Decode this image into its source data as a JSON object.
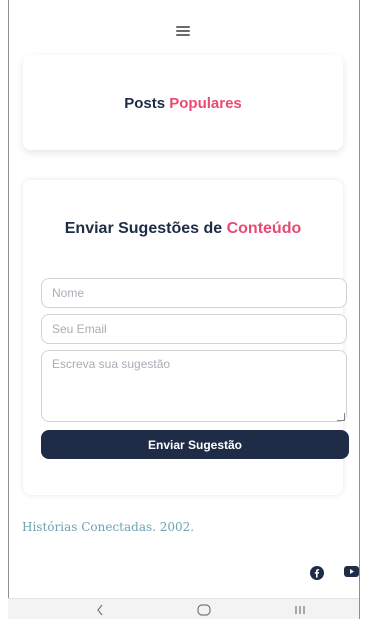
{
  "header": {
    "menu_icon": "hamburger-menu-icon"
  },
  "popular": {
    "title_part1": "Posts ",
    "title_part2": "Populares"
  },
  "suggestion_form": {
    "title_part1": "Enviar Sugestões de ",
    "title_part2": "Conteúdo",
    "name_placeholder": "Nome",
    "email_placeholder": "Seu Email",
    "message_placeholder": "Escreva sua sugestão",
    "submit_label": "Enviar Sugestão"
  },
  "footer": {
    "text": "Histórias Conectadas. 2002.",
    "social_icons": [
      "facebook-icon",
      "youtube-icon"
    ]
  },
  "system_nav": {
    "buttons": [
      "back-icon",
      "home-icon",
      "recent-apps-icon"
    ]
  },
  "colors": {
    "accent": "#e94a73",
    "navy": "#1f2c47",
    "footer_text": "#6fa3b3"
  }
}
